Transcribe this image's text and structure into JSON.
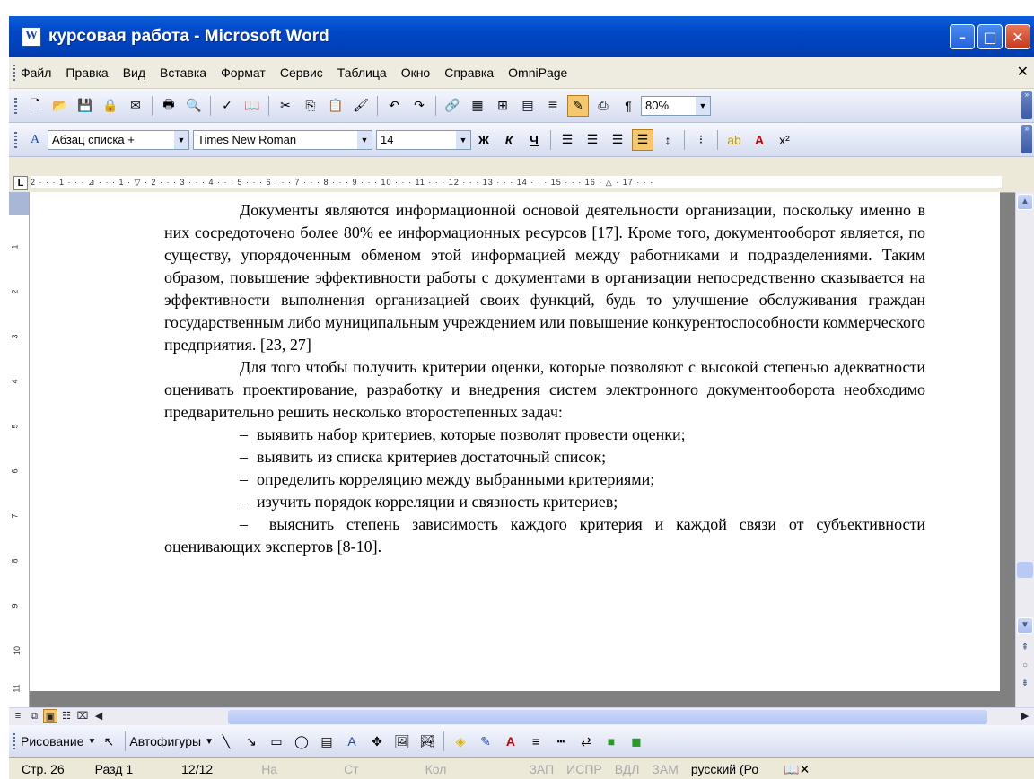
{
  "window": {
    "title": "курсовая работа - Microsoft Word"
  },
  "menu": {
    "items": [
      "Файл",
      "Правка",
      "Вид",
      "Вставка",
      "Формат",
      "Сервис",
      "Таблица",
      "Окно",
      "Справка",
      "OmniPage"
    ]
  },
  "toolbar": {
    "zoom": "80%"
  },
  "format_toolbar": {
    "style": "Абзац списка +",
    "font": "Times New Roman",
    "size": "14"
  },
  "ruler": {
    "marks": "2 · · · 1 · · · ⊿ · · · 1 · ▽ · 2 · · · 3 · · · 4 · · · 5 · · · 6 · · · 7 · · · 8 · · · 9 · · · 10 · · · 11 · · · 12 · · · 13 · · · 14 · · · 15 · · · 16 · △ · 17 · · ·",
    "vmarks": [
      "1",
      "2",
      "3",
      "4",
      "5",
      "6",
      "7",
      "8",
      "9",
      "10",
      "11"
    ]
  },
  "document": {
    "para1": "Документы являются информационной основой деятельности организации, поскольку именно в них сосредоточено более 80% ее информационных ресурсов [17]. Кроме того, документооборот является, по существу, упорядоченным обменом этой информацией между работниками и подразделениями. Таким образом, повышение эффективности работы с документами в организации непосредственно сказывается на эффективности выполнения организацией своих функций, будь то улучшение обслуживания граждан государственным либо муниципальным учреждением или повышение конкурентоспособности коммерческого предприятия. [23, 27]",
    "para2": "Для того чтобы получить критерии оценки, которые позволяют с высокой степенью адекватности оценивать проектирование, разработку и внедрения систем электронного документооборота необходимо предварительно решить несколько второстепенных задач:",
    "list": [
      "выявить набор критериев, которые позволят провести оценки;",
      "выявить из списка критериев достаточный список;",
      "определить корреляцию между выбранными критериями;",
      "изучить порядок корреляции и связность критериев;"
    ],
    "list_last": "выяснить степень зависимость каждого критерия и каждой связи от субъективности оценивающих экспертов [8-10]."
  },
  "drawing": {
    "draw_label": "Рисование",
    "autoshapes_label": "Автофигуры"
  },
  "status": {
    "page": "Стр. 26",
    "section": "Разд 1",
    "pages": "12/12",
    "at": "На",
    "line": "Ст",
    "col": "Кол",
    "rec": "ЗАП",
    "trk": "ИСПР",
    "ext": "ВДЛ",
    "ovr": "ЗАМ",
    "lang": "русский (Ро"
  }
}
